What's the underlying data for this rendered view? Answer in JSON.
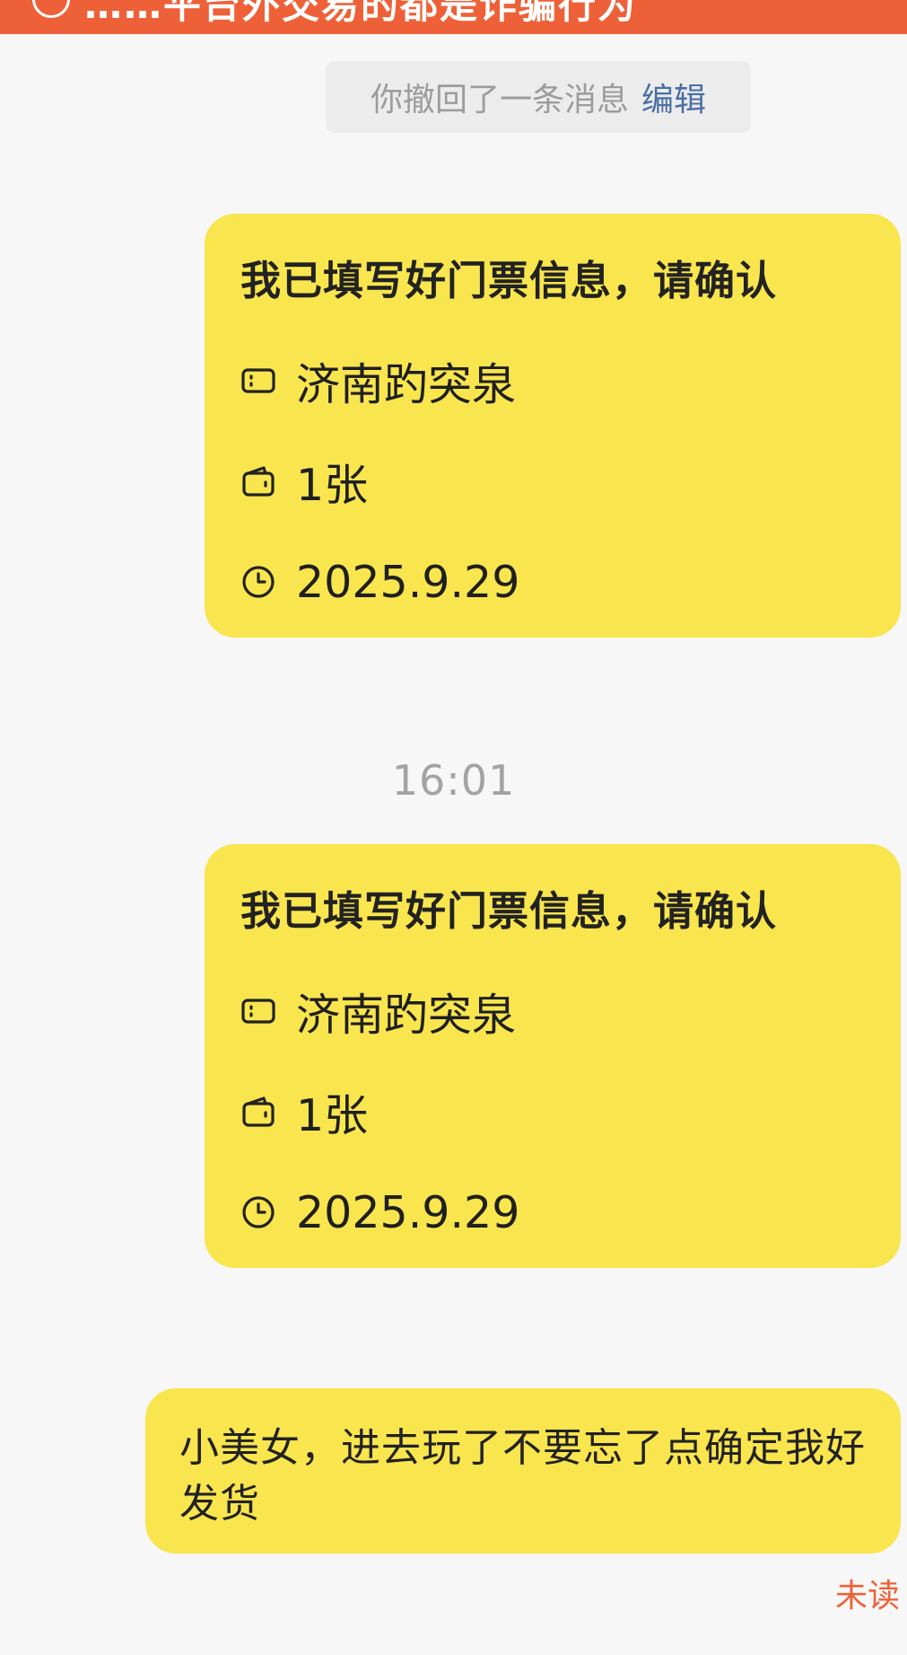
{
  "banner": {
    "text": "……平台外交易的都是诈骗行为",
    "icon": "warning-circle-icon",
    "color": "#ee6138"
  },
  "recall": {
    "text": "你撤回了一条消息",
    "edit_label": "编辑"
  },
  "cards": [
    {
      "title": "我已填写好门票信息，请确认",
      "location": "济南趵突泉",
      "quantity": "1张",
      "date": "2025.9.29"
    },
    {
      "title": "我已填写好门票信息，请确认",
      "location": "济南趵突泉",
      "quantity": "1张",
      "date": "2025.9.29"
    }
  ],
  "timestamp": "16:01",
  "message": {
    "text": "小美女，进去玩了不要忘了点确定我好发货"
  },
  "status": {
    "unread": "未读"
  },
  "colors": {
    "bubble": "#f9e54e",
    "link": "#4a6fa5",
    "accent": "#ee6138"
  }
}
